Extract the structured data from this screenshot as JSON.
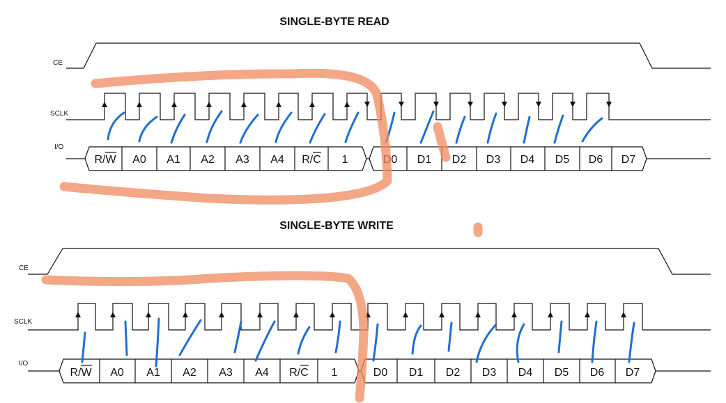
{
  "read": {
    "title": "SINGLE-BYTE READ",
    "signals": {
      "ce": "CE",
      "sclk": "SCLK",
      "io": "I/O"
    },
    "io_cells": [
      "R/W",
      "A0",
      "A1",
      "A2",
      "A3",
      "A4",
      "R/C",
      "1",
      "D0",
      "D1",
      "D2",
      "D3",
      "D4",
      "D5",
      "D6",
      "D7"
    ]
  },
  "write": {
    "title": "SINGLE-BYTE WRITE",
    "signals": {
      "ce": "CE",
      "sclk": "SCLK",
      "io": "I/O"
    },
    "io_cells": [
      "R/W",
      "A0",
      "A1",
      "A2",
      "A3",
      "A4",
      "R/C",
      "1",
      "D0",
      "D1",
      "D2",
      "D3",
      "D4",
      "D5",
      "D6",
      "D7"
    ]
  },
  "colors": {
    "annotation_blue": "#1f6fd0",
    "annotation_orange": "#f08a5d",
    "line": "#111111"
  }
}
